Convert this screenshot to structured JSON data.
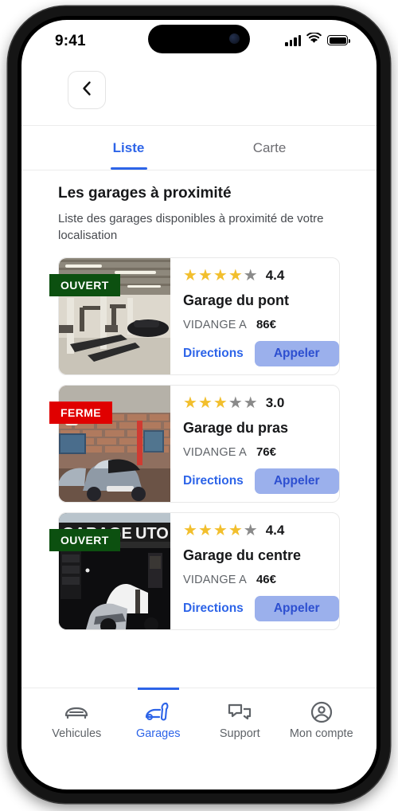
{
  "status_bar": {
    "time": "9:41",
    "signal_icon": "cellular-signal-icon",
    "wifi_icon": "wifi-icon",
    "battery_icon": "battery-icon"
  },
  "header": {
    "back_icon": "chevron-left-icon"
  },
  "tabs": [
    {
      "label": "Liste",
      "active": true
    },
    {
      "label": "Carte",
      "active": false
    }
  ],
  "main": {
    "title": "Les garages à proximité",
    "subtitle": "Liste des garages disponibles à proximité de votre localisation"
  },
  "garages": [
    {
      "status": "OUVERT",
      "status_type": "open",
      "rating": "4.4",
      "stars_filled": 4,
      "stars_total": 5,
      "name": "Garage du pont",
      "service_label": "VIDANGE A",
      "price": "86€",
      "directions_label": "Directions",
      "call_label": "Appeler",
      "photo": "garage-interior-lifts"
    },
    {
      "status": "FERME",
      "status_type": "closed",
      "rating": "3.0",
      "stars_filled": 3,
      "stars_total": 5,
      "name": "Garage du pras",
      "service_label": "VIDANGE A",
      "price": "76€",
      "directions_label": "Directions",
      "call_label": "Appeler",
      "photo": "brick-garage-silver-car"
    },
    {
      "status": "OUVERT",
      "status_type": "open",
      "rating": "4.4",
      "stars_filled": 4,
      "stars_total": 5,
      "name": "Garage du centre",
      "service_label": "VIDANGE A",
      "price": "46€",
      "directions_label": "Directions",
      "call_label": "Appeler",
      "photo": "dark-garage-open-hood"
    }
  ],
  "bottom_nav": [
    {
      "label": "Vehicules",
      "icon": "car-icon",
      "active": false
    },
    {
      "label": "Garages",
      "icon": "car-wrench-icon",
      "active": true
    },
    {
      "label": "Support",
      "icon": "chat-bubbles-icon",
      "active": false
    },
    {
      "label": "Mon compte",
      "icon": "account-circle-icon",
      "active": false
    }
  ],
  "colors": {
    "accent": "#2d64e8",
    "open_badge": "#0c5010",
    "closed_badge": "#e00000",
    "star_filled": "#f2bf2d",
    "star_empty": "#8a8a8a",
    "call_button_bg": "#9bb0ec"
  }
}
